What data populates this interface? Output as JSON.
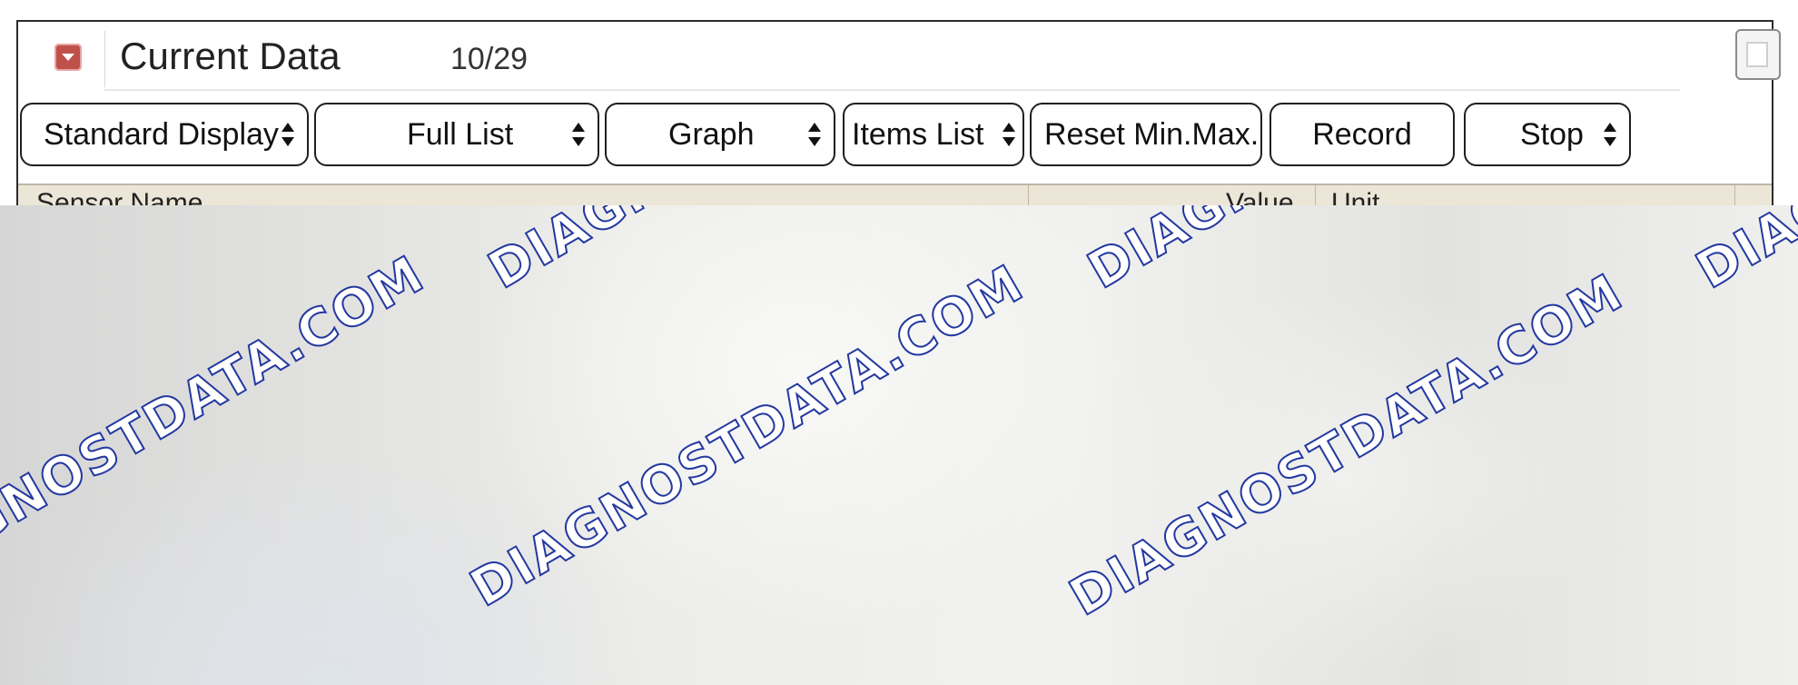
{
  "window": {
    "title": "Current Data",
    "count": "10/29"
  },
  "toolbar": {
    "buttons": [
      {
        "label": "Standard Display",
        "has_arrows": true
      },
      {
        "label": "Full List",
        "has_arrows": true
      },
      {
        "label": "Graph",
        "has_arrows": true
      },
      {
        "label": "Items List",
        "has_arrows": true
      },
      {
        "label": "Reset Min.Max.",
        "has_arrows": false
      },
      {
        "label": "Record",
        "has_arrows": false
      },
      {
        "label": "Stop",
        "has_arrows": true
      }
    ]
  },
  "table": {
    "headers": {
      "sensor": "Sensor Name",
      "value": "Value",
      "unit": "Unit"
    },
    "header_bg": "#ebe6d7"
  },
  "watermark": {
    "brand": "DIAGNOSTDATA.COM",
    "color": "#2338a0"
  },
  "icons": {
    "collapse": "collapse-arrow-icon",
    "window_corner": "window-restore-icon"
  }
}
